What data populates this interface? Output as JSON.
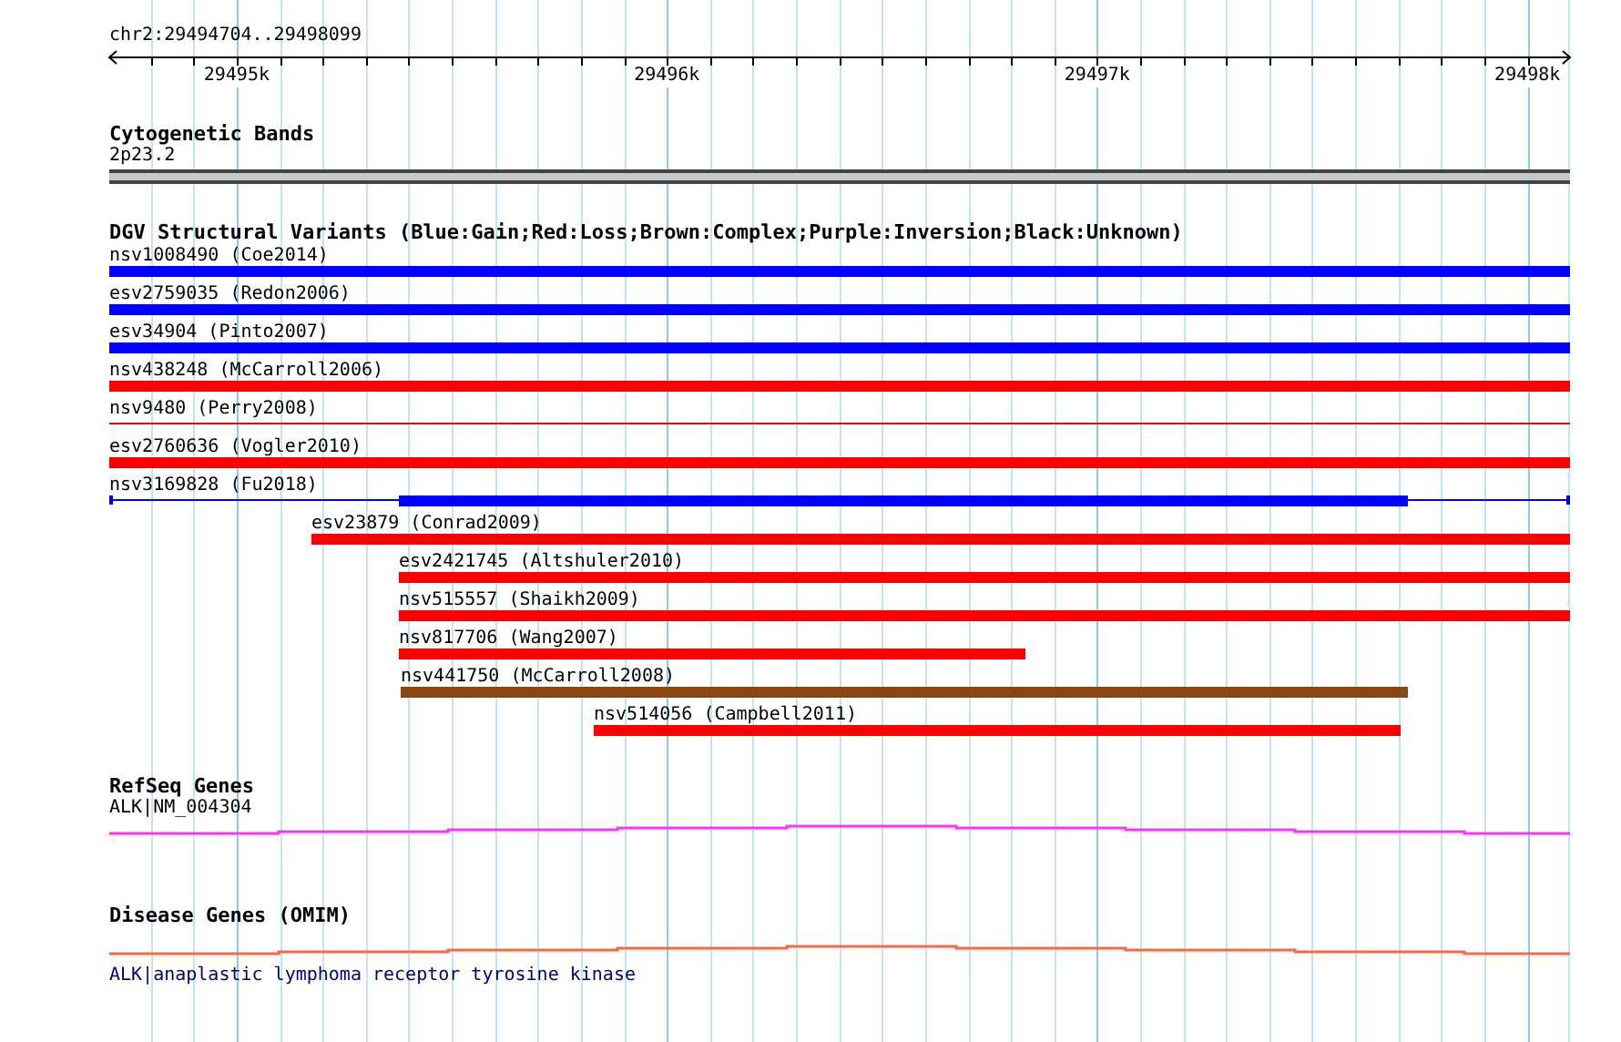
{
  "ruler": {
    "location": "chr2:29494704..29498099",
    "ticks": [
      "29495k",
      "29496k",
      "29497k",
      "29498k"
    ]
  },
  "cytogenetic_bands": {
    "title": "Cytogenetic Bands",
    "band": "2p23.2"
  },
  "structural_variants": {
    "title": "DGV Structural Variants (Blue:Gain;Red:Loss;Brown:Complex;Purple:Inversion;Black:Unknown)",
    "items": [
      {
        "label": "nsv1008490 (Coe2014)",
        "kind": "thick",
        "color": "#0000ff"
      },
      {
        "label": "esv2759035 (Redon2006)",
        "kind": "thick",
        "color": "#0000ff"
      },
      {
        "label": "esv34904 (Pinto2007)",
        "kind": "thick",
        "color": "#0000ff"
      },
      {
        "label": "nsv438248 (McCarroll2006)",
        "kind": "thick",
        "color": "#ff0000"
      },
      {
        "label": "nsv9480 (Perry2008)",
        "kind": "thin",
        "color": "#ff0000"
      },
      {
        "label": "esv2760636 (Vogler2010)",
        "kind": "thick",
        "color": "#ff0000"
      },
      {
        "label": "nsv3169828 (Fu2018)",
        "kind": "thick-thin",
        "color": "#0000ff"
      },
      {
        "label": "esv23879 (Conrad2009)",
        "kind": "thick",
        "color": "#ff0000"
      },
      {
        "label": "esv2421745 (Altshuler2010)",
        "kind": "thick",
        "color": "#ff0000"
      },
      {
        "label": "nsv515557 (Shaikh2009)",
        "kind": "thick",
        "color": "#ff0000"
      },
      {
        "label": "nsv817706 (Wang2007)",
        "kind": "thick",
        "color": "#ff0000"
      },
      {
        "label": "nsv441750 (McCarroll2008)",
        "kind": "thick",
        "color": "#8b4513"
      },
      {
        "label": "nsv514056 (Campbell2011)",
        "kind": "thick",
        "color": "#ff0000"
      }
    ]
  },
  "refseq_genes": {
    "title": "RefSeq Genes",
    "gene": "ALK|NM_004304"
  },
  "disease_genes": {
    "title": "Disease Genes (OMIM)",
    "link": "ALK|anaplastic lymphoma receptor tyrosine kinase"
  }
}
